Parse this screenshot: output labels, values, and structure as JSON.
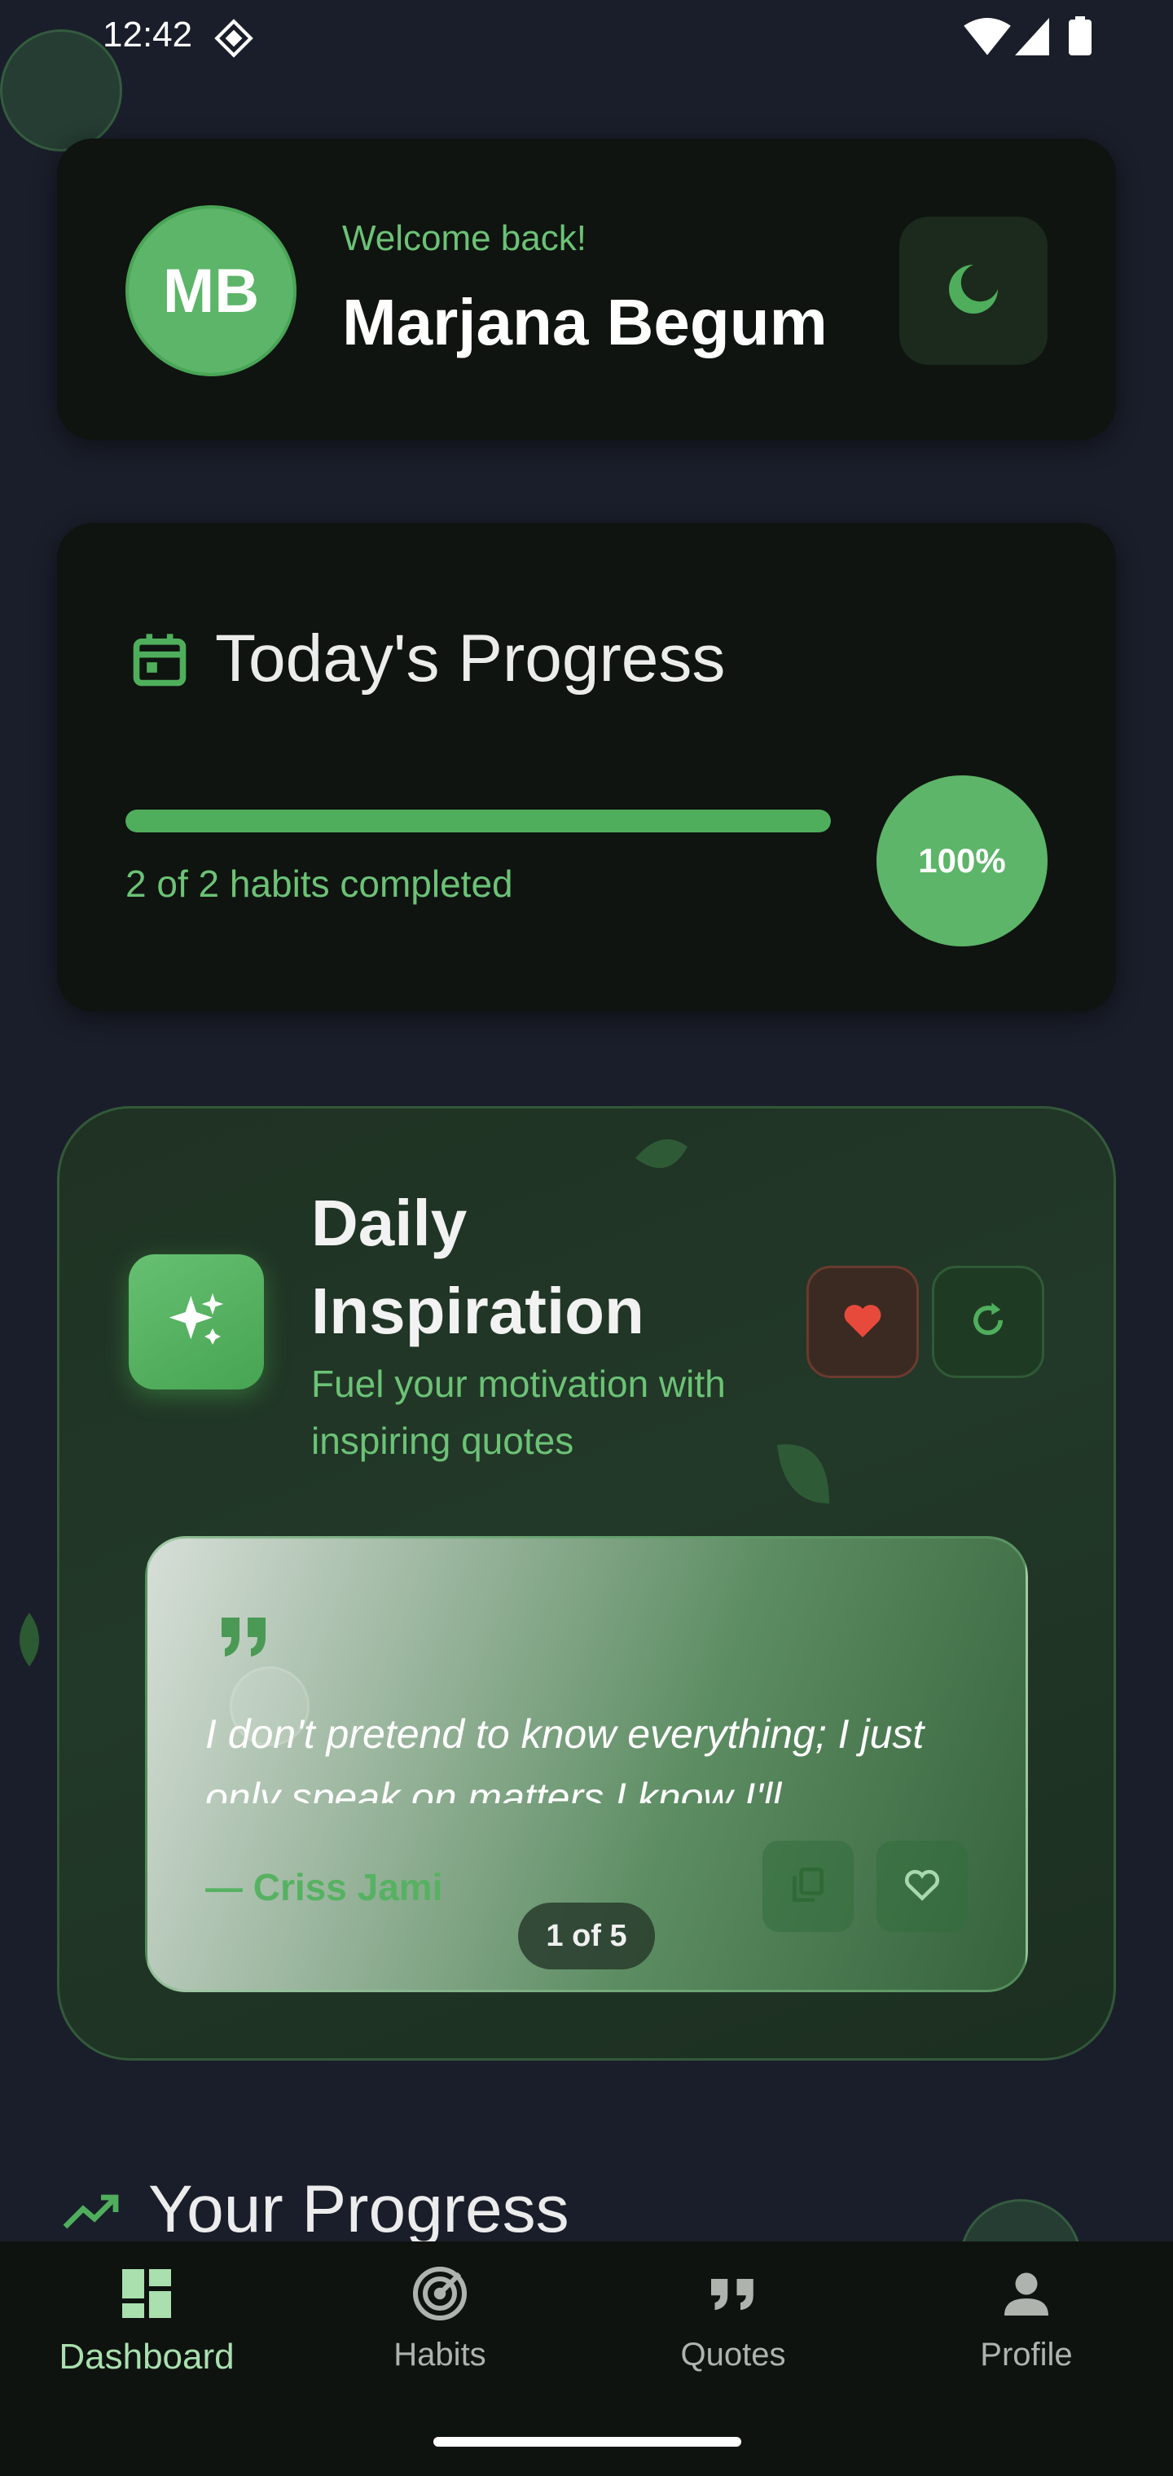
{
  "status_bar": {
    "time": "12:42",
    "icons": [
      "notification-diamond-icon",
      "wifi-icon",
      "signal-icon",
      "battery-icon"
    ]
  },
  "header": {
    "avatar_initials": "MB",
    "welcome_text": "Welcome back!",
    "user_name": "Marjana Begum",
    "theme_toggle_icon": "moon-icon"
  },
  "todays_progress": {
    "title": "Today's Progress",
    "icon": "calendar-icon",
    "progress_fraction": 1.0,
    "completed_text": "2 of 2 habits completed",
    "percent_label": "100%"
  },
  "daily_inspiration": {
    "title": "Daily Inspiration",
    "subtitle": "Fuel your motivation with inspiring quotes",
    "quote_text": "I don't pretend to know everything; I just only speak on matters I know I'll",
    "quote_author": "— Criss Jami",
    "page_indicator": "1 of 5"
  },
  "your_progress": {
    "title": "Your Progress"
  },
  "bottom_nav": {
    "items": [
      {
        "label": "Dashboard",
        "icon": "dashboard-icon",
        "active": true
      },
      {
        "label": "Habits",
        "icon": "target-icon",
        "active": false
      },
      {
        "label": "Quotes",
        "icon": "quote-icon",
        "active": false
      },
      {
        "label": "Profile",
        "icon": "person-icon",
        "active": false
      }
    ]
  },
  "colors": {
    "background": "#1a1e2a",
    "card": "#0f1410",
    "accent_green": "#5cb568",
    "text_green": "#6cc276",
    "heart_red": "#e74a3b"
  }
}
